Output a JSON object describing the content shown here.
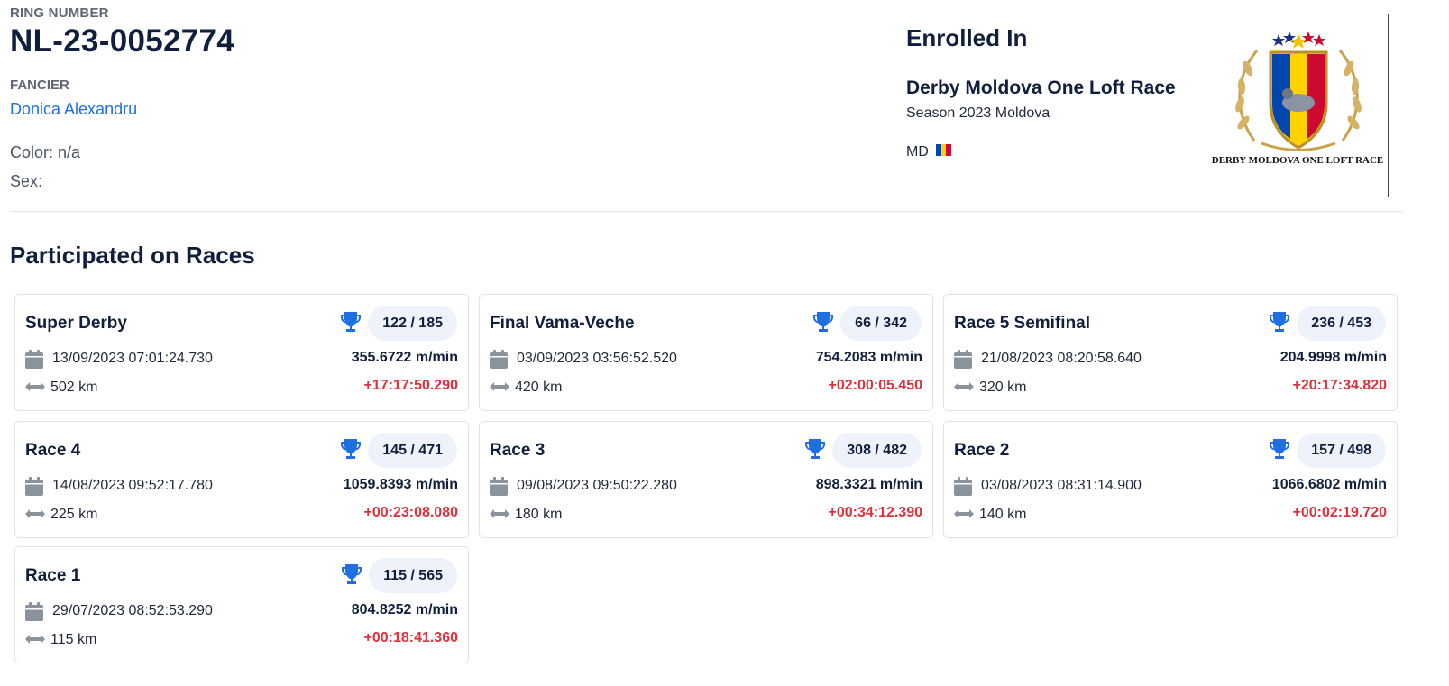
{
  "header": {
    "ring_label": "RING NUMBER",
    "ring_number": "NL-23-0052774",
    "fancier_label": "FANCIER",
    "fancier_name": "Donica Alexandru",
    "color_line": "Color: n/a",
    "sex_line": "Sex:"
  },
  "enrolled": {
    "title": "Enrolled In",
    "race_name": "Derby Moldova One Loft Race",
    "season": "Season 2023 Moldova",
    "country_code": "MD",
    "flag_colors": [
      "#0046ae",
      "#ffd200",
      "#cc092f"
    ],
    "logo_caption": "DERBY MOLDOVA ONE LOFT RACE"
  },
  "section_title": "Participated on Races",
  "colors": {
    "accent_blue": "#1f6fe0",
    "diff_red": "#e0303a",
    "pill_bg": "#eef3fb",
    "icon_gray": "#8a929c"
  },
  "races": [
    {
      "name": "Super Derby",
      "rank": "122 / 185",
      "datetime": "13/09/2023 07:01:24.730",
      "speed": "355.6722 m/min",
      "distance": "502 km",
      "diff": "+17:17:50.290"
    },
    {
      "name": "Final Vama-Veche",
      "rank": "66 / 342",
      "datetime": "03/09/2023 03:56:52.520",
      "speed": "754.2083 m/min",
      "distance": "420 km",
      "diff": "+02:00:05.450"
    },
    {
      "name": "Race 5 Semifinal",
      "rank": "236 / 453",
      "datetime": "21/08/2023 08:20:58.640",
      "speed": "204.9998 m/min",
      "distance": "320 km",
      "diff": "+20:17:34.820"
    },
    {
      "name": "Race 4",
      "rank": "145 / 471",
      "datetime": "14/08/2023 09:52:17.780",
      "speed": "1059.8393 m/min",
      "distance": "225 km",
      "diff": "+00:23:08.080"
    },
    {
      "name": "Race 3",
      "rank": "308 / 482",
      "datetime": "09/08/2023 09:50:22.280",
      "speed": "898.3321 m/min",
      "distance": "180 km",
      "diff": "+00:34:12.390"
    },
    {
      "name": "Race 2",
      "rank": "157 / 498",
      "datetime": "03/08/2023 08:31:14.900",
      "speed": "1066.6802 m/min",
      "distance": "140 km",
      "diff": "+00:02:19.720"
    },
    {
      "name": "Race 1",
      "rank": "115 / 565",
      "datetime": "29/07/2023 08:52:53.290",
      "speed": "804.8252 m/min",
      "distance": "115 km",
      "diff": "+00:18:41.360"
    }
  ]
}
